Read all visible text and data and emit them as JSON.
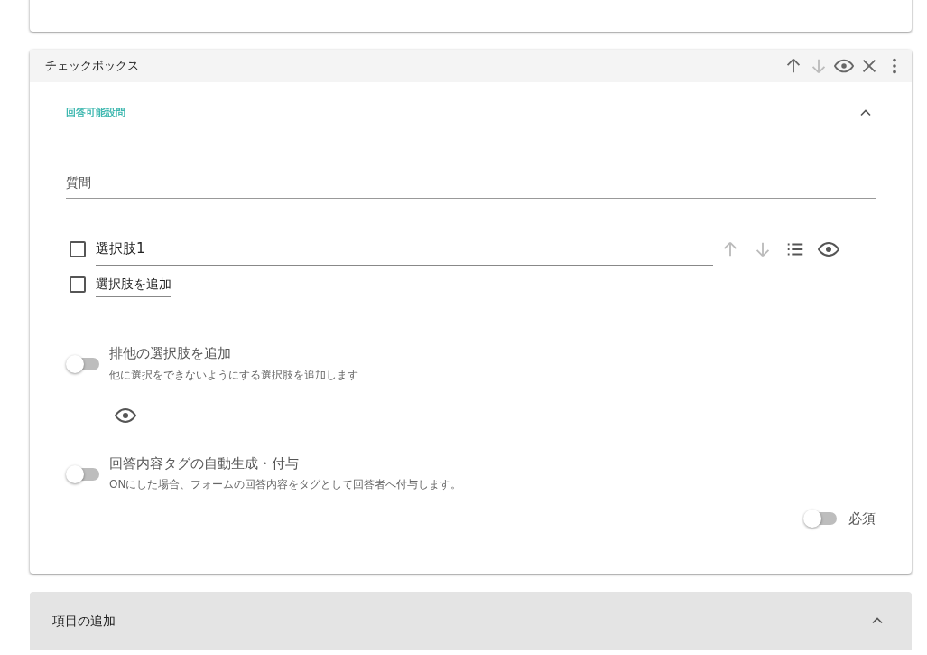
{
  "question_card": {
    "title": "チェックボックス",
    "header_actions": [
      {
        "kind": "up",
        "disabled": false
      },
      {
        "kind": "down",
        "disabled": true
      },
      {
        "kind": "eye",
        "disabled": false
      },
      {
        "kind": "close",
        "disabled": false
      },
      {
        "kind": "more",
        "disabled": false
      }
    ],
    "section": {
      "label": "回答可能設問",
      "expanded": true
    },
    "question_field": {
      "placeholder": "質問"
    },
    "choices": [
      {
        "value": "選択肢1",
        "checked": false
      }
    ],
    "add_choice": {
      "label": "選択肢を追加",
      "checked": false
    },
    "exclusive_toggle": {
      "title": "排他の選択肢を追加",
      "description": "他に選択をできないようにする選択肢を追加します",
      "on": false
    },
    "tag_toggle": {
      "title": "回答内容タグの自動生成・付与",
      "description": "ONにした場合、フォームの回答内容をタグとして回答者へ付与します。",
      "on": false
    },
    "required_toggle": {
      "label": "必須",
      "on": false
    }
  },
  "add_item_panel": {
    "title": "項目の追加",
    "expanded": true
  }
}
